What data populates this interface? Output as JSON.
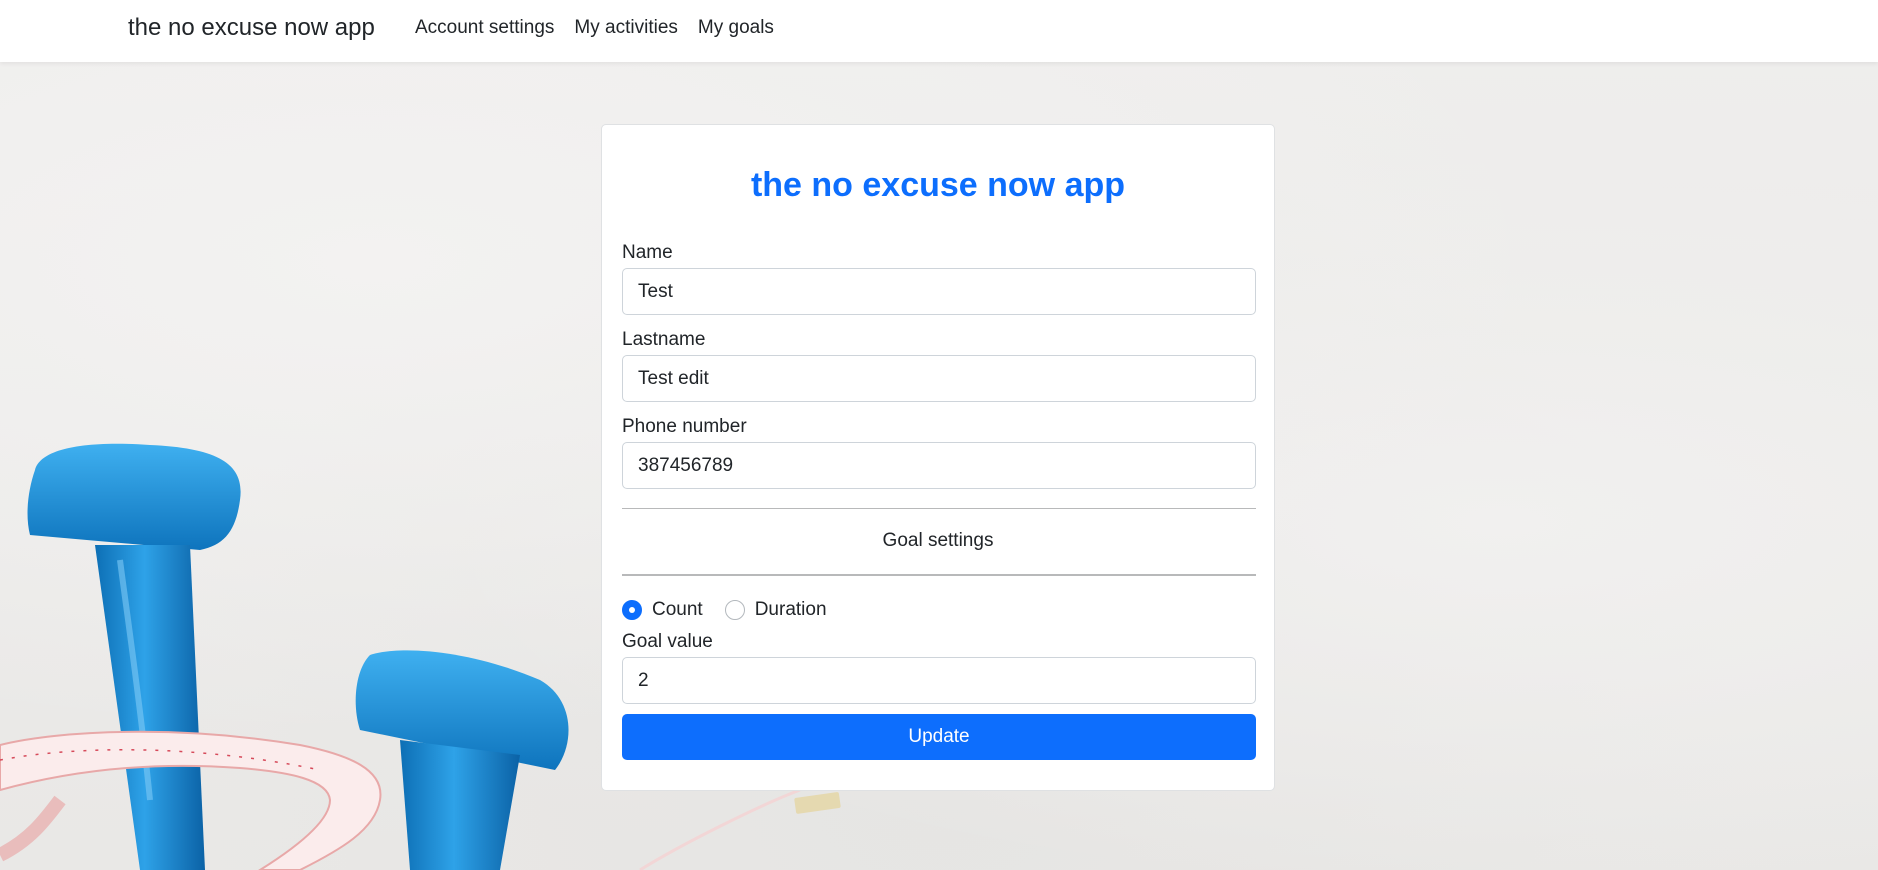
{
  "navbar": {
    "brand": "the no excuse now app",
    "links": [
      "Account settings",
      "My activities",
      "My goals"
    ]
  },
  "card": {
    "title": "the no excuse now app",
    "fields": {
      "name": {
        "label": "Name",
        "value": "Test"
      },
      "lastname": {
        "label": "Lastname",
        "value": "Test edit"
      },
      "phone": {
        "label": "Phone number",
        "value": "387456789"
      }
    },
    "goal_section_title": "Goal settings",
    "goal_type": {
      "options": [
        "Count",
        "Duration"
      ],
      "selected": "Count"
    },
    "goal_value": {
      "label": "Goal value",
      "value": "2"
    },
    "submit_label": "Update"
  },
  "colors": {
    "accent": "#0d6efd",
    "dumbbell": "#1a8fd6",
    "background": "#ecebea"
  },
  "icons": {
    "decoration": "dumbbells-and-tape-illustration"
  }
}
